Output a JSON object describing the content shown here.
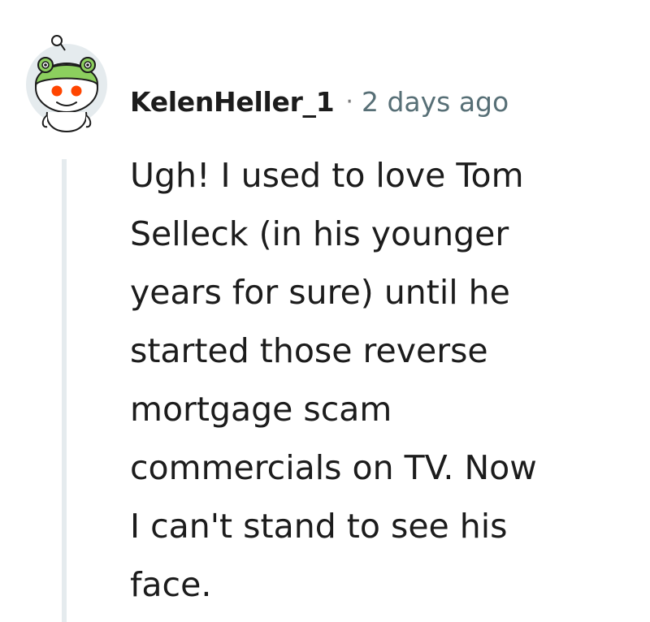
{
  "comment": {
    "author": "KelenHeller_1",
    "separator": "·",
    "timestamp": "2 days ago",
    "body": "Ugh! I used to love Tom\nSelleck (in his younger\nyears for sure) until he\nstarted those reverse\nmortgage scam\ncommercials on TV. Now\nI can't stand to see his\nface.",
    "avatar_icon": "snoo-frog-hat-avatar-icon",
    "colors": {
      "text": "#1c1c1c",
      "meta": "#576f76",
      "thread_line": "#e5ebee",
      "avatar_bg": "#e5ebee",
      "hat_green": "#8ccf5e",
      "snoo_eye": "#ff4500"
    }
  }
}
